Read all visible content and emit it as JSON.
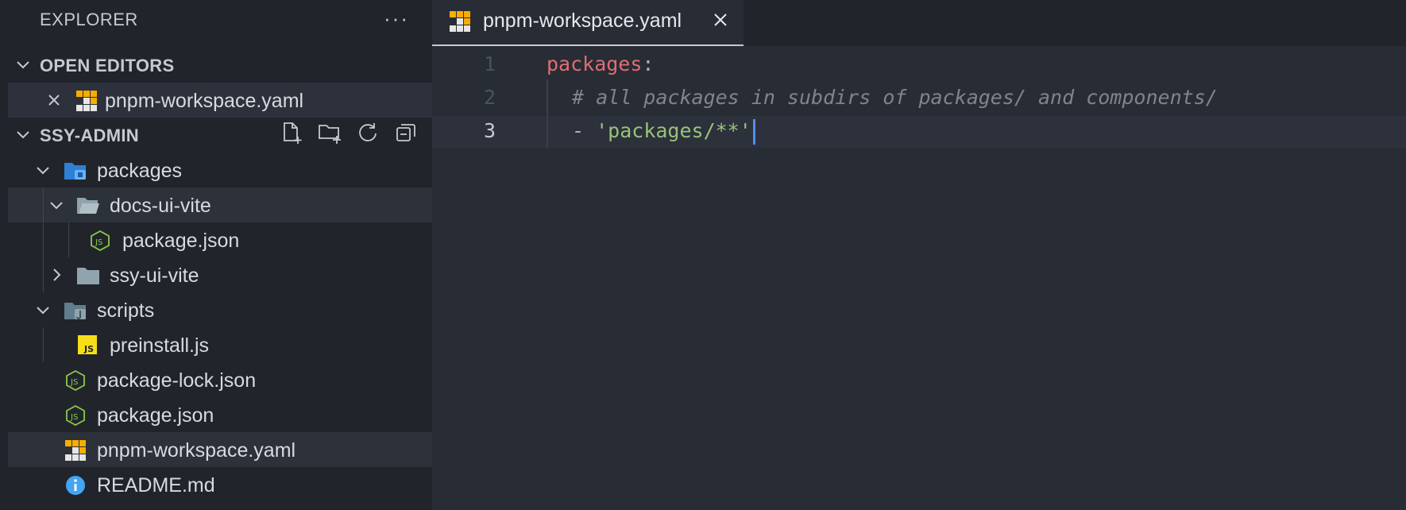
{
  "sidebar": {
    "title": "EXPLORER",
    "more_label": "···",
    "open_editors": {
      "header": "OPEN EDITORS",
      "items": [
        {
          "label": "pnpm-workspace.yaml",
          "icon": "pnpm-icon"
        }
      ]
    },
    "project": {
      "header": "SSY-ADMIN",
      "actions": [
        "new-file-icon",
        "new-folder-icon",
        "refresh-icon",
        "collapse-all-icon"
      ],
      "tree": [
        {
          "label": "packages",
          "type": "folder",
          "expanded": true
        },
        {
          "label": "docs-ui-vite",
          "type": "folder",
          "expanded": true
        },
        {
          "label": "package.json",
          "type": "file"
        },
        {
          "label": "ssy-ui-vite",
          "type": "folder",
          "expanded": false
        },
        {
          "label": "scripts",
          "type": "folder",
          "expanded": true
        },
        {
          "label": "preinstall.js",
          "type": "file"
        },
        {
          "label": "package-lock.json",
          "type": "file"
        },
        {
          "label": "package.json",
          "type": "file"
        },
        {
          "label": "pnpm-workspace.yaml",
          "type": "file"
        },
        {
          "label": "README.md",
          "type": "file"
        }
      ]
    }
  },
  "editor": {
    "tab": {
      "label": "pnpm-workspace.yaml"
    },
    "lines": [
      {
        "number": "1",
        "key": "packages",
        "colon": ":"
      },
      {
        "number": "2",
        "comment": "# all packages in subdirs of packages/ and components/"
      },
      {
        "number": "3",
        "dash": "- ",
        "string": "'packages/**'"
      }
    ]
  },
  "colors": {
    "accent": "#528bff",
    "sidebar_bg": "#21252b",
    "editor_bg": "#282c34",
    "keyword": "#e06c75",
    "string": "#98c379",
    "comment": "#7f848e"
  }
}
